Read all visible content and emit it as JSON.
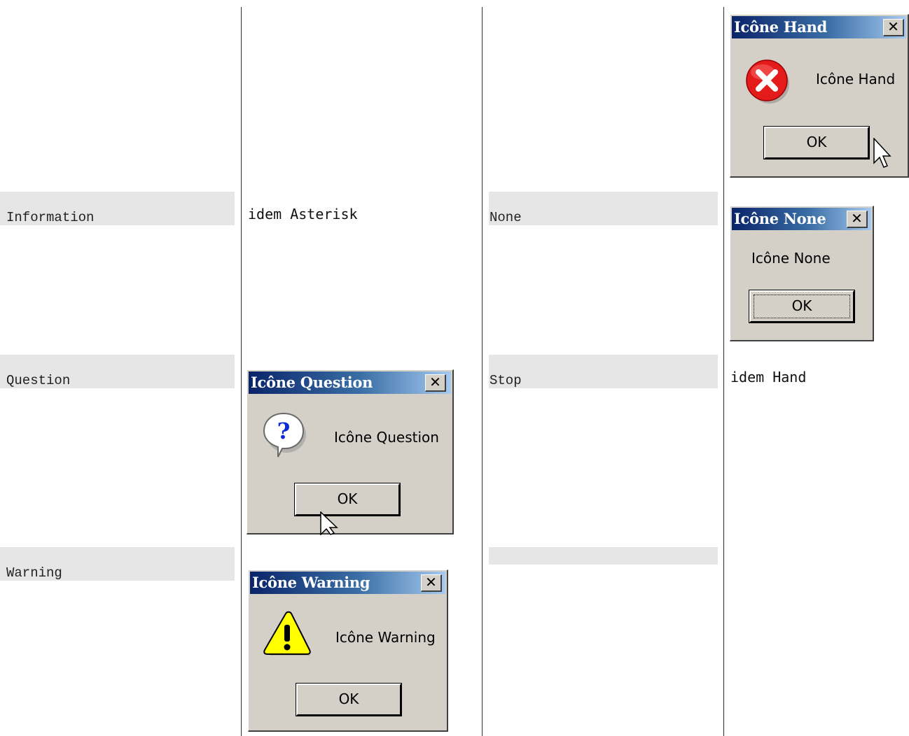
{
  "rows": [
    {
      "label": "Information",
      "note": "idem Asterisk",
      "label2": "None"
    },
    {
      "label": "Question",
      "label2": "Stop",
      "note2": "idem Hand"
    },
    {
      "label": "Warning",
      "label2": ""
    }
  ],
  "dialogs": {
    "hand": {
      "title": "Icône Hand",
      "message": "Icône Hand",
      "ok": "OK",
      "close": "✕",
      "icon": "error-icon"
    },
    "none": {
      "title": "Icône None",
      "message": "Icône None",
      "ok": "OK",
      "close": "✕"
    },
    "question": {
      "title": "Icône Question",
      "message": "Icône Question",
      "ok": "OK",
      "close": "✕",
      "icon": "question-icon"
    },
    "warning": {
      "title": "Icône Warning",
      "message": "Icône Warning",
      "ok": "OK",
      "close": "✕",
      "icon": "warning-icon"
    }
  },
  "colors": {
    "titlebar_start": "#0a246a",
    "titlebar_end": "#a6caf0",
    "dialog_bg": "#d4d0c8",
    "label_bg": "#e6e6e6"
  }
}
